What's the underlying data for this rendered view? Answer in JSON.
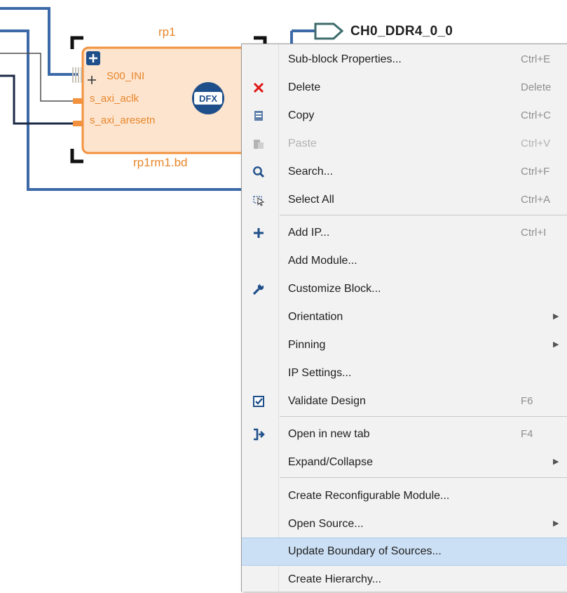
{
  "diagram": {
    "block_name": "rp1",
    "block_source": "rp1rm1.bd",
    "block_badge": "DFX",
    "ports": [
      "S00_INI",
      "s_axi_aclk",
      "s_axi_aresetn"
    ],
    "external_port": "CH0_DDR4_0_0",
    "colors": {
      "wire_blue": "#3c6aa8",
      "wire_dark": "#1b2a44",
      "block_fill": "#fde4cf",
      "block_border": "#f2923e",
      "port_text": "#e8862a"
    }
  },
  "menu": {
    "items": [
      {
        "label": "Sub-block Properties...",
        "shortcut": "Ctrl+E",
        "icon": "none"
      },
      {
        "label": "Delete",
        "shortcut": "Delete",
        "icon": "delete-x-icon"
      },
      {
        "label": "Copy",
        "shortcut": "Ctrl+C",
        "icon": "copy-icon"
      },
      {
        "label": "Paste",
        "shortcut": "Ctrl+V",
        "icon": "paste-icon",
        "disabled": true
      },
      {
        "label": "Search...",
        "shortcut": "Ctrl+F",
        "icon": "search-icon"
      },
      {
        "label": "Select All",
        "shortcut": "Ctrl+A",
        "icon": "select-all-icon"
      },
      {
        "label": "Add IP...",
        "shortcut": "Ctrl+I",
        "icon": "plus-icon"
      },
      {
        "label": "Add Module...",
        "shortcut": "",
        "icon": "none"
      },
      {
        "label": "Customize Block...",
        "shortcut": "",
        "icon": "wrench-icon"
      },
      {
        "label": "Orientation",
        "shortcut": "",
        "icon": "none",
        "submenu": true
      },
      {
        "label": "Pinning",
        "shortcut": "",
        "icon": "none",
        "submenu": true
      },
      {
        "label": "IP Settings...",
        "shortcut": "",
        "icon": "none"
      },
      {
        "label": "Validate Design",
        "shortcut": "F6",
        "icon": "validate-checkbox-icon"
      },
      {
        "label": "Open in new tab",
        "shortcut": "F4",
        "icon": "open-tab-icon"
      },
      {
        "label": "Expand/Collapse",
        "shortcut": "",
        "icon": "none",
        "submenu": true
      },
      {
        "label": "Create Reconfigurable Module...",
        "shortcut": "",
        "icon": "none"
      },
      {
        "label": "Open Source...",
        "shortcut": "",
        "icon": "none",
        "submenu": true
      },
      {
        "label": "Update Boundary of Sources...",
        "shortcut": "",
        "icon": "none",
        "highlighted": true
      },
      {
        "label": "Create Hierarchy...",
        "shortcut": "",
        "icon": "none"
      }
    ]
  }
}
